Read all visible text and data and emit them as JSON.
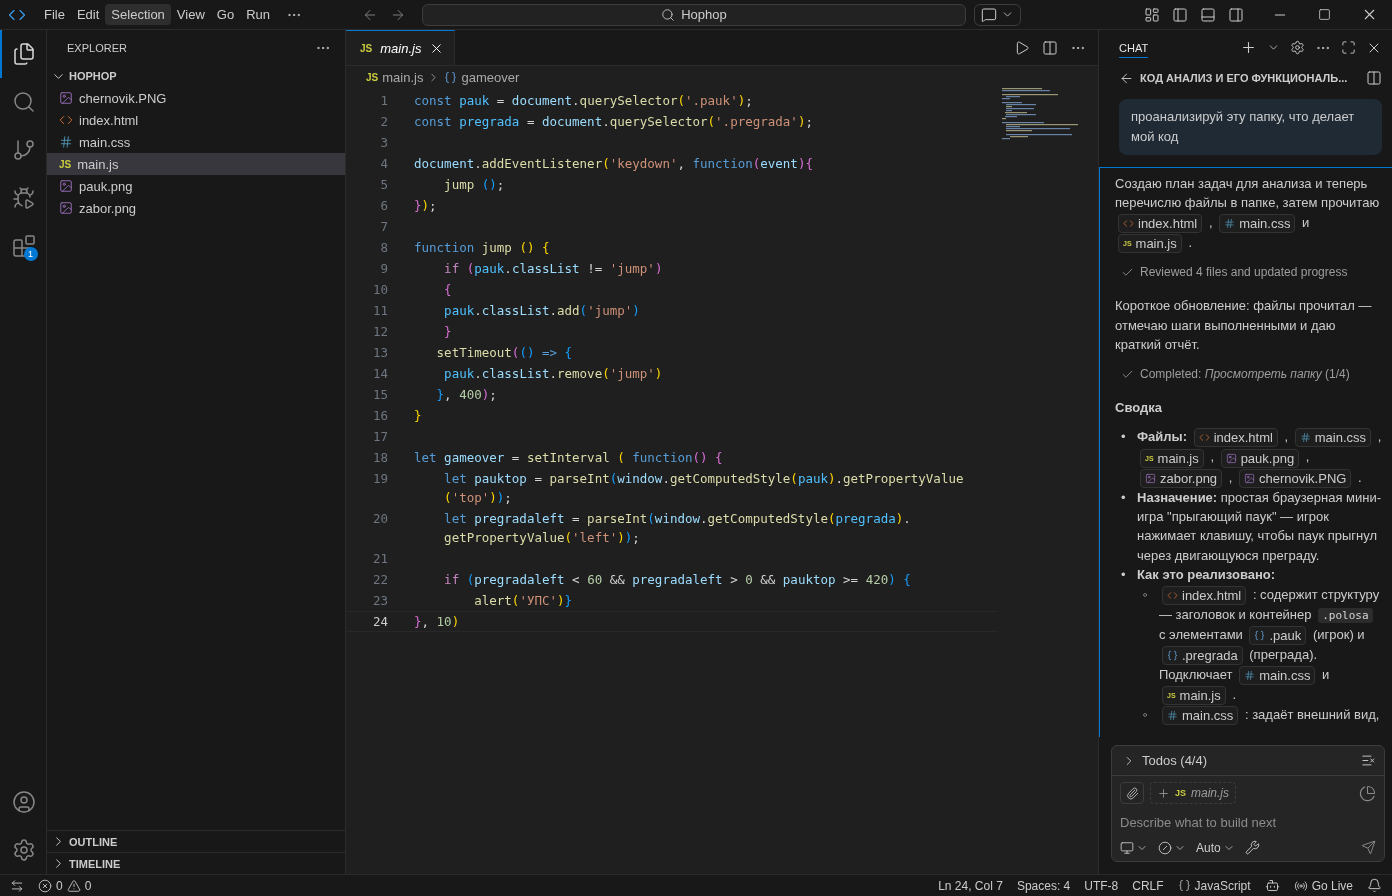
{
  "titlebar": {
    "menus": [
      {
        "label": "File",
        "selected": false
      },
      {
        "label": "Edit",
        "selected": false
      },
      {
        "label": "Selection",
        "selected": true
      },
      {
        "label": "View",
        "selected": false
      },
      {
        "label": "Go",
        "selected": false
      },
      {
        "label": "Run",
        "selected": false
      }
    ],
    "search": {
      "value": "Hophop"
    }
  },
  "activity_bar": {
    "items": [
      {
        "kind": "explorer",
        "selected": true
      },
      {
        "kind": "search",
        "selected": false
      },
      {
        "kind": "source-control",
        "selected": false
      },
      {
        "kind": "run-debug",
        "selected": false
      },
      {
        "kind": "extensions",
        "selected": false,
        "badge": "1"
      }
    ]
  },
  "sidebar": {
    "title": "EXPLORER",
    "folder": {
      "name": "HOPHOP",
      "expanded": true,
      "files": [
        {
          "name": "chernovik.PNG",
          "kind": "png",
          "selected": false
        },
        {
          "name": "index.html",
          "kind": "html",
          "selected": false
        },
        {
          "name": "main.css",
          "kind": "css",
          "selected": false
        },
        {
          "name": "main.js",
          "kind": "js",
          "icon_label": "JS",
          "selected": true
        },
        {
          "name": "pauk.png",
          "kind": "png",
          "selected": false
        },
        {
          "name": "zabor.png",
          "kind": "png",
          "selected": false
        }
      ]
    },
    "sections": [
      {
        "title": "OUTLINE",
        "expanded": false
      },
      {
        "title": "TIMELINE",
        "expanded": false
      }
    ]
  },
  "editor": {
    "tab": {
      "label": "main.js",
      "icon_label": "JS",
      "preview": true
    },
    "breadcrumb": [
      {
        "kind": "file",
        "label": "main.js",
        "icon_label": "JS"
      },
      {
        "kind": "symbol",
        "label": "gameover"
      }
    ],
    "lines": [
      {
        "number": "1",
        "current": false,
        "rows": [
          [
            {
              "kind": "keyword",
              "text": "const"
            },
            {
              "kind": "plain",
              "text": " "
            },
            {
              "kind": "constant",
              "text": "pauk"
            },
            {
              "kind": "plain",
              "text": " = "
            },
            {
              "kind": "variable",
              "text": "document"
            },
            {
              "kind": "plain",
              "text": "."
            },
            {
              "kind": "function",
              "text": "querySelector"
            },
            {
              "kind": "bracket1",
              "text": "("
            },
            {
              "kind": "string",
              "text": "'.pauk'"
            },
            {
              "kind": "bracket1",
              "text": ")"
            },
            {
              "kind": "plain",
              "text": ";"
            }
          ]
        ]
      },
      {
        "number": "2",
        "current": false,
        "rows": [
          [
            {
              "kind": "keyword",
              "text": "const"
            },
            {
              "kind": "plain",
              "text": " "
            },
            {
              "kind": "constant",
              "text": "pregrada"
            },
            {
              "kind": "plain",
              "text": " = "
            },
            {
              "kind": "variable",
              "text": "document"
            },
            {
              "kind": "plain",
              "text": "."
            },
            {
              "kind": "function",
              "text": "querySelector"
            },
            {
              "kind": "bracket1",
              "text": "("
            },
            {
              "kind": "string",
              "text": "'.pregrada'"
            },
            {
              "kind": "bracket1",
              "text": ")"
            },
            {
              "kind": "plain",
              "text": ";"
            }
          ]
        ]
      },
      {
        "number": "3",
        "current": false
      },
      {
        "number": "4",
        "current": false,
        "rows": [
          [
            {
              "kind": "variable",
              "text": "document"
            },
            {
              "kind": "plain",
              "text": "."
            },
            {
              "kind": "function",
              "text": "addEventListener"
            },
            {
              "kind": "bracket1",
              "text": "("
            },
            {
              "kind": "string",
              "text": "'keydown'"
            },
            {
              "kind": "plain",
              "text": ", "
            },
            {
              "kind": "keyword",
              "text": "function"
            },
            {
              "kind": "bracket2",
              "text": "("
            },
            {
              "kind": "variable",
              "text": "event"
            },
            {
              "kind": "bracket2",
              "text": ")"
            },
            {
              "kind": "bracket2",
              "text": "{"
            }
          ]
        ]
      },
      {
        "number": "5",
        "current": false,
        "rows": [
          [
            {
              "kind": "plain",
              "text": "    "
            },
            {
              "kind": "function",
              "text": "jump"
            },
            {
              "kind": "plain",
              "text": " "
            },
            {
              "kind": "bracket3",
              "text": "()"
            },
            {
              "kind": "plain",
              "text": ";"
            }
          ]
        ]
      },
      {
        "number": "6",
        "current": false,
        "rows": [
          [
            {
              "kind": "bracket2",
              "text": "}"
            },
            {
              "kind": "bracket1",
              "text": ")"
            },
            {
              "kind": "plain",
              "text": ";"
            }
          ]
        ]
      },
      {
        "number": "7",
        "current": false
      },
      {
        "number": "8",
        "current": false,
        "rows": [
          [
            {
              "kind": "keyword",
              "text": "function"
            },
            {
              "kind": "plain",
              "text": " "
            },
            {
              "kind": "function",
              "text": "jump"
            },
            {
              "kind": "plain",
              "text": " "
            },
            {
              "kind": "bracket1",
              "text": "()"
            },
            {
              "kind": "plain",
              "text": " "
            },
            {
              "kind": "bracket1",
              "text": "{"
            }
          ]
        ]
      },
      {
        "number": "9",
        "current": false,
        "rows": [
          [
            {
              "kind": "plain",
              "text": "    "
            },
            {
              "kind": "control",
              "text": "if"
            },
            {
              "kind": "plain",
              "text": " "
            },
            {
              "kind": "bracket2",
              "text": "("
            },
            {
              "kind": "constant",
              "text": "pauk"
            },
            {
              "kind": "plain",
              "text": "."
            },
            {
              "kind": "variable",
              "text": "classList"
            },
            {
              "kind": "plain",
              "text": " != "
            },
            {
              "kind": "string",
              "text": "'jump'"
            },
            {
              "kind": "bracket2",
              "text": ")"
            }
          ]
        ]
      },
      {
        "number": "10",
        "current": false,
        "rows": [
          [
            {
              "kind": "plain",
              "text": "    "
            },
            {
              "kind": "bracket2",
              "text": "{"
            }
          ]
        ]
      },
      {
        "number": "11",
        "current": false,
        "rows": [
          [
            {
              "kind": "plain",
              "text": "    "
            },
            {
              "kind": "constant",
              "text": "pauk"
            },
            {
              "kind": "plain",
              "text": "."
            },
            {
              "kind": "variable",
              "text": "classList"
            },
            {
              "kind": "plain",
              "text": "."
            },
            {
              "kind": "function",
              "text": "add"
            },
            {
              "kind": "bracket3",
              "text": "("
            },
            {
              "kind": "string",
              "text": "'jump'"
            },
            {
              "kind": "bracket3",
              "text": ")"
            }
          ]
        ]
      },
      {
        "number": "12",
        "current": false,
        "rows": [
          [
            {
              "kind": "plain",
              "text": "    "
            },
            {
              "kind": "bracket2",
              "text": "}"
            }
          ]
        ]
      },
      {
        "number": "13",
        "current": false,
        "rows": [
          [
            {
              "kind": "plain",
              "text": "   "
            },
            {
              "kind": "function",
              "text": "setTimeout"
            },
            {
              "kind": "bracket2",
              "text": "("
            },
            {
              "kind": "bracket3",
              "text": "()"
            },
            {
              "kind": "plain",
              "text": " "
            },
            {
              "kind": "keyword",
              "text": "=>"
            },
            {
              "kind": "plain",
              "text": " "
            },
            {
              "kind": "bracket3",
              "text": "{"
            }
          ]
        ]
      },
      {
        "number": "14",
        "current": false,
        "rows": [
          [
            {
              "kind": "plain",
              "text": "    "
            },
            {
              "kind": "constant",
              "text": "pauk"
            },
            {
              "kind": "plain",
              "text": "."
            },
            {
              "kind": "variable",
              "text": "classList"
            },
            {
              "kind": "plain",
              "text": "."
            },
            {
              "kind": "function",
              "text": "remove"
            },
            {
              "kind": "bracket1",
              "text": "("
            },
            {
              "kind": "string",
              "text": "'jump'"
            },
            {
              "kind": "bracket1",
              "text": ")"
            }
          ]
        ]
      },
      {
        "number": "15",
        "current": false,
        "rows": [
          [
            {
              "kind": "plain",
              "text": "   "
            },
            {
              "kind": "bracket3",
              "text": "}"
            },
            {
              "kind": "plain",
              "text": ", "
            },
            {
              "kind": "number",
              "text": "400"
            },
            {
              "kind": "bracket2",
              "text": ")"
            },
            {
              "kind": "plain",
              "text": ";"
            }
          ]
        ]
      },
      {
        "number": "16",
        "current": false,
        "rows": [
          [
            {
              "kind": "bracket1",
              "text": "}"
            }
          ]
        ]
      },
      {
        "number": "17",
        "current": false
      },
      {
        "number": "18",
        "current": false,
        "rows": [
          [
            {
              "kind": "keyword",
              "text": "let"
            },
            {
              "kind": "plain",
              "text": " "
            },
            {
              "kind": "variable",
              "text": "gameover"
            },
            {
              "kind": "plain",
              "text": " = "
            },
            {
              "kind": "function",
              "text": "setInterval"
            },
            {
              "kind": "plain",
              "text": " "
            },
            {
              "kind": "bracket1",
              "text": "("
            },
            {
              "kind": "plain",
              "text": " "
            },
            {
              "kind": "keyword",
              "text": "function"
            },
            {
              "kind": "bracket2",
              "text": "()"
            },
            {
              "kind": "plain",
              "text": " "
            },
            {
              "kind": "bracket2",
              "text": "{"
            }
          ]
        ]
      },
      {
        "number": "19",
        "current": false,
        "rows": [
          [
            {
              "kind": "plain",
              "text": "    "
            },
            {
              "kind": "keyword",
              "text": "let"
            },
            {
              "kind": "plain",
              "text": " "
            },
            {
              "kind": "variable",
              "text": "pauktop"
            },
            {
              "kind": "plain",
              "text": " = "
            },
            {
              "kind": "function",
              "text": "parseInt"
            },
            {
              "kind": "bracket3",
              "text": "("
            },
            {
              "kind": "variable",
              "text": "window"
            },
            {
              "kind": "plain",
              "text": "."
            },
            {
              "kind": "function",
              "text": "getComputedStyle"
            },
            {
              "kind": "bracket1",
              "text": "("
            },
            {
              "kind": "constant",
              "text": "pauk"
            },
            {
              "kind": "bracket1",
              "text": ")"
            },
            {
              "kind": "plain",
              "text": "."
            },
            {
              "kind": "function",
              "text": "getPropertyValue"
            },
            {
              "kind": "break"
            },
            {
              "kind": "plain",
              "text": "    "
            },
            {
              "kind": "bracket1",
              "text": "("
            },
            {
              "kind": "string",
              "text": "'top'"
            },
            {
              "kind": "bracket1",
              "text": ")"
            },
            {
              "kind": "bracket3",
              "text": ")"
            },
            {
              "kind": "plain",
              "text": ";"
            }
          ]
        ]
      },
      {
        "number": "20",
        "current": false,
        "rows": [
          [
            {
              "kind": "plain",
              "text": "    "
            },
            {
              "kind": "keyword",
              "text": "let"
            },
            {
              "kind": "plain",
              "text": " "
            },
            {
              "kind": "variable",
              "text": "pregradaleft"
            },
            {
              "kind": "plain",
              "text": " = "
            },
            {
              "kind": "function",
              "text": "parseInt"
            },
            {
              "kind": "bracket3",
              "text": "("
            },
            {
              "kind": "variable",
              "text": "window"
            },
            {
              "kind": "plain",
              "text": "."
            },
            {
              "kind": "function",
              "text": "getComputedStyle"
            },
            {
              "kind": "bracket1",
              "text": "("
            },
            {
              "kind": "constant",
              "text": "pregrada"
            },
            {
              "kind": "bracket1",
              "text": ")"
            },
            {
              "kind": "plain",
              "text": "."
            },
            {
              "kind": "break"
            },
            {
              "kind": "plain",
              "text": "    "
            },
            {
              "kind": "function",
              "text": "getPropertyValue"
            },
            {
              "kind": "bracket1",
              "text": "("
            },
            {
              "kind": "string",
              "text": "'left'"
            },
            {
              "kind": "bracket1",
              "text": ")"
            },
            {
              "kind": "bracket3",
              "text": ")"
            },
            {
              "kind": "plain",
              "text": ";"
            }
          ]
        ]
      },
      {
        "number": "21",
        "current": false
      },
      {
        "number": "22",
        "current": false,
        "rows": [
          [
            {
              "kind": "plain",
              "text": "    "
            },
            {
              "kind": "control",
              "text": "if"
            },
            {
              "kind": "plain",
              "text": " "
            },
            {
              "kind": "bracket3",
              "text": "("
            },
            {
              "kind": "variable",
              "text": "pregradaleft"
            },
            {
              "kind": "plain",
              "text": " < "
            },
            {
              "kind": "number",
              "text": "60"
            },
            {
              "kind": "plain",
              "text": " && "
            },
            {
              "kind": "variable",
              "text": "pregradaleft"
            },
            {
              "kind": "plain",
              "text": " > "
            },
            {
              "kind": "number",
              "text": "0"
            },
            {
              "kind": "plain",
              "text": " && "
            },
            {
              "kind": "variable",
              "text": "pauktop"
            },
            {
              "kind": "plain",
              "text": " >= "
            },
            {
              "kind": "number",
              "text": "420"
            },
            {
              "kind": "bracket3",
              "text": ")"
            },
            {
              "kind": "plain",
              "text": " "
            },
            {
              "kind": "bracket3",
              "text": "{"
            }
          ]
        ]
      },
      {
        "number": "23",
        "current": false,
        "rows": [
          [
            {
              "kind": "plain",
              "text": "        "
            },
            {
              "kind": "function",
              "text": "alert"
            },
            {
              "kind": "bracket1",
              "text": "("
            },
            {
              "kind": "string",
              "text": "'УПС'"
            },
            {
              "kind": "bracket1",
              "text": ")"
            },
            {
              "kind": "bracket3",
              "text": "}"
            }
          ]
        ]
      },
      {
        "number": "24",
        "current": true,
        "rows": [
          [
            {
              "kind": "bracket2",
              "text": "}"
            },
            {
              "kind": "plain",
              "text": ", "
            },
            {
              "kind": "number",
              "text": "10"
            },
            {
              "kind": "bracket1",
              "text": ")"
            }
          ]
        ]
      }
    ]
  },
  "chat": {
    "tab": "CHAT",
    "title": "КОД АНАЛИЗ И ЕГО ФУНКЦИОНАЛЬ...",
    "user_message": "проанализируй эту папку, что делает мой код",
    "response": [
      {
        "kind": "paragraph",
        "parts": [
          {
            "kind": "text",
            "text": "Создаю план задач для анализа и теперь"
          },
          {
            "kind": "text",
            "text": "перечислю файлы в папке, затем прочитаю"
          },
          {
            "kind": "html",
            "text": "index.html"
          },
          {
            "kind": "text",
            "text": ","
          },
          {
            "kind": "css",
            "text": "main.css"
          },
          {
            "kind": "text",
            "text": "и"
          },
          {
            "kind": "js",
            "text": "main.js",
            "icon_label": "JS"
          },
          {
            "kind": "text",
            "text": "."
          }
        ]
      },
      {
        "kind": "status",
        "text": "Reviewed 4 files and updated progress"
      },
      {
        "kind": "paragraph",
        "parts": [
          {
            "kind": "text",
            "text": "Короткое обновление: файлы прочитал — отмечаю шаги выполненными и даю краткий отчёт."
          }
        ]
      },
      {
        "kind": "status",
        "text": "Completed: *Просмотреть папку* (1/4)"
      },
      {
        "kind": "heading",
        "text": "Сводка"
      },
      {
        "kind": "list",
        "items": [
          {
            "marker": "•",
            "parts": [
              {
                "kind": "text",
                "text": "**Файлы:**"
              },
              {
                "kind": "html",
                "text": "index.html"
              },
              {
                "kind": "text",
                "text": ","
              },
              {
                "kind": "css",
                "text": "main.css"
              },
              {
                "kind": "text",
                "text": ","
              },
              {
                "kind": "js",
                "text": "main.js",
                "icon_label": "JS"
              },
              {
                "kind": "text",
                "text": ","
              },
              {
                "kind": "png",
                "text": "pauk.png"
              },
              {
                "kind": "text",
                "text": ","
              },
              {
                "kind": "png",
                "text": "zabor.png"
              },
              {
                "kind": "text",
                "text": ","
              },
              {
                "kind": "png",
                "text": "chernovik.PNG"
              },
              {
                "kind": "text",
                "text": "."
              }
            ]
          },
          {
            "marker": "•",
            "parts": [
              {
                "kind": "text",
                "text": "**Назначение:** простая браузерная мини-игра \"прыгающий паук\" — игрок нажимает клавишу, чтобы паук прыгнул через двигающуюся преграду."
              }
            ]
          },
          {
            "marker": "•",
            "parts": [
              {
                "kind": "text",
                "text": "**Как это реализовано:**"
              }
            ],
            "children": [
              {
                "marker": "◦",
                "parts": [
                  {
                    "kind": "html",
                    "text": "index.html"
                  },
                  {
                    "kind": "text",
                    "text": ": содержит структуру"
                  },
                  {
                    "kind": "text",
                    "text": "— заголовок и контейнер"
                  },
                  {
                    "kind": "code",
                    "text": ".polosa"
                  },
                  {
                    "kind": "text",
                    "text": "с элементами"
                  },
                  {
                    "kind": "symbol",
                    "text": ".pauk"
                  },
                  {
                    "kind": "text",
                    "text": "(игрок) и"
                  },
                  {
                    "kind": "symbol",
                    "text": ".pregrada"
                  },
                  {
                    "kind": "text",
                    "text": "(преграда)."
                  },
                  {
                    "kind": "text",
                    "text": "Подключает"
                  },
                  {
                    "kind": "css",
                    "text": "main.css"
                  },
                  {
                    "kind": "text",
                    "text": "и"
                  },
                  {
                    "kind": "js",
                    "text": "main.js",
                    "icon_label": "JS"
                  },
                  {
                    "kind": "text",
                    "text": "."
                  }
                ]
              },
              {
                "marker": "◦",
                "parts": [
                  {
                    "kind": "css",
                    "text": "main.css"
                  },
                  {
                    "kind": "text",
                    "text": ": задаёт внешний вид,"
                  }
                ]
              }
            ]
          }
        ]
      }
    ],
    "todos": {
      "label": "Todos (4/4)",
      "expanded": false
    },
    "input": {
      "context": {
        "label": "main.js",
        "icon_label": "JS"
      },
      "placeholder": "Describe what to build next",
      "model": "Auto"
    }
  },
  "status_bar": {
    "errors": "0",
    "warnings": "0",
    "items": [
      {
        "kind": "text",
        "text": "Ln 24, Col 7"
      },
      {
        "kind": "text",
        "text": "Spaces: 4"
      },
      {
        "kind": "text",
        "text": "UTF-8"
      },
      {
        "kind": "text",
        "text": "CRLF"
      },
      {
        "kind": "language",
        "text": "JavaScript"
      },
      {
        "kind": "copilot"
      },
      {
        "kind": "live",
        "text": "Go Live"
      },
      {
        "kind": "notifications"
      }
    ]
  }
}
